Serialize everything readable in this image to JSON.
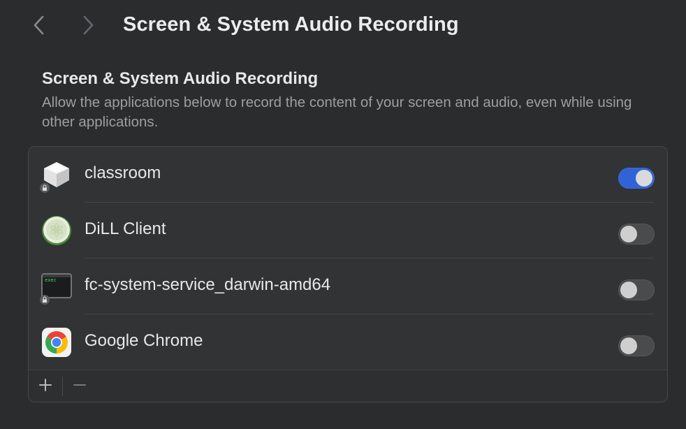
{
  "toolbar": {
    "title": "Screen & System Audio Recording",
    "back_icon": "chevron-left-icon",
    "forward_icon": "chevron-right-icon"
  },
  "section": {
    "title": "Screen & System Audio Recording",
    "description": "Allow the applications below to record the content of your screen and audio, even while using other applications."
  },
  "apps": [
    {
      "name": "classroom",
      "icon": "classroom-app-icon",
      "locked": true,
      "enabled": true
    },
    {
      "name": "DiLL Client",
      "icon": "dill-client-app-icon",
      "locked": false,
      "enabled": false
    },
    {
      "name": "fc-system-service_darwin-amd64",
      "icon": "terminal-exec-icon",
      "icon_text": "exec",
      "locked": true,
      "enabled": false
    },
    {
      "name": "Google Chrome",
      "icon": "google-chrome-icon",
      "locked": false,
      "enabled": false
    }
  ],
  "footer": {
    "add_icon": "plus-icon",
    "remove_icon": "minus-icon"
  },
  "colors": {
    "background": "#2b2c2e",
    "panel": "#323335",
    "toggle_on": "#2f63d6",
    "toggle_off": "#4a4b4d",
    "text_primary": "#e8e8e8",
    "text_secondary": "#9d9ea0"
  }
}
